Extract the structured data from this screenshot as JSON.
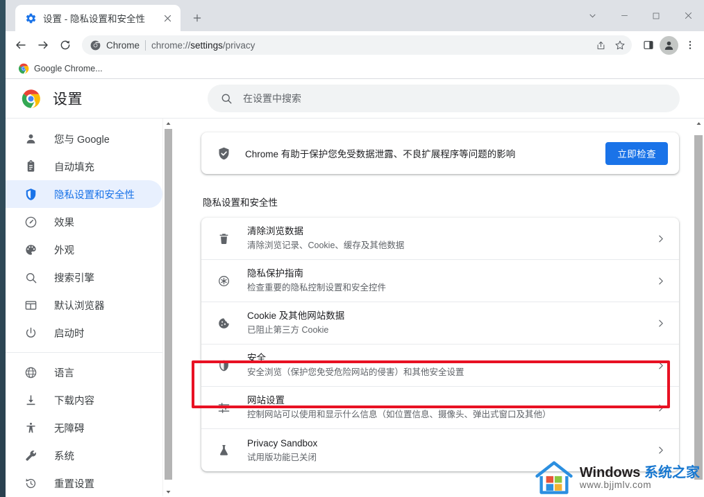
{
  "window": {
    "controls": [
      {
        "name": "tab-search-button",
        "glyph": "chevron-down"
      },
      {
        "name": "minimize-button",
        "glyph": "minimize"
      },
      {
        "name": "maximize-button",
        "glyph": "maximize"
      },
      {
        "name": "close-button",
        "glyph": "close"
      }
    ]
  },
  "tab": {
    "title": "设置 - 隐私设置和安全性",
    "favicon": "gear-icon",
    "close_label": "×",
    "newtab_label": "+"
  },
  "toolbar": {
    "back": "back-arrow-icon",
    "forward": "forward-arrow-icon",
    "reload": "reload-icon",
    "omnibox": {
      "chip_label": "Chrome",
      "chip_icon": "chrome-icon",
      "url_prefix": "chrome://",
      "url_bold": "settings",
      "url_suffix": "/privacy",
      "share_icon": "share-icon",
      "bookmark_icon": "star-icon"
    },
    "side_panel": "side-panel-icon",
    "profile": "profile-avatar-icon",
    "menu": "three-dot-menu-icon"
  },
  "bookmarks": [
    {
      "label": "Google Chrome...",
      "icon": "chrome-icon"
    }
  ],
  "settings": {
    "brand_title": "设置",
    "brand_icon": "chrome-logo-icon",
    "search": {
      "placeholder": "在设置中搜索",
      "value": "",
      "icon": "search-icon"
    },
    "sidebar": {
      "group_a": [
        {
          "label": "您与 Google",
          "icon": "person-icon",
          "active": false
        },
        {
          "label": "自动填充",
          "icon": "clipboard-icon",
          "active": false
        },
        {
          "label": "隐私设置和安全性",
          "icon": "shield-icon",
          "active": true
        },
        {
          "label": "效果",
          "icon": "speedometer-icon",
          "active": false
        },
        {
          "label": "外观",
          "icon": "palette-icon",
          "active": false
        },
        {
          "label": "搜索引擎",
          "icon": "search-icon",
          "active": false
        },
        {
          "label": "默认浏览器",
          "icon": "browser-window-icon",
          "active": false
        },
        {
          "label": "启动时",
          "icon": "power-icon",
          "active": false
        }
      ],
      "group_b": [
        {
          "label": "语言",
          "icon": "globe-icon",
          "active": false
        },
        {
          "label": "下载内容",
          "icon": "download-icon",
          "active": false
        },
        {
          "label": "无障碍",
          "icon": "accessibility-icon",
          "active": false
        },
        {
          "label": "系统",
          "icon": "wrench-icon",
          "active": false
        },
        {
          "label": "重置设置",
          "icon": "history-restore-icon",
          "active": false
        }
      ]
    },
    "safety_check": {
      "icon": "shield-check-icon",
      "text": "Chrome 有助于保护您免受数据泄露、不良扩展程序等问题的影响",
      "button_label": "立即检查"
    },
    "section_title": "隐私设置和安全性",
    "rows": [
      {
        "icon": "trash-icon",
        "title": "清除浏览数据",
        "sub": "清除浏览记录、Cookie、缓存及其他数据",
        "highlighted": false
      },
      {
        "icon": "privacy-guide-icon",
        "title": "隐私保护指南",
        "sub": "检查重要的隐私控制设置和安全控件",
        "highlighted": false
      },
      {
        "icon": "cookie-icon",
        "title": "Cookie 及其他网站数据",
        "sub": "已阻止第三方 Cookie",
        "highlighted": false
      },
      {
        "icon": "shield-icon",
        "title": "安全",
        "sub": "安全浏览（保护您免受危险网站的侵害）和其他安全设置",
        "highlighted": false
      },
      {
        "icon": "tune-sliders-icon",
        "title": "网站设置",
        "sub": "控制网站可以使用和显示什么信息（如位置信息、摄像头、弹出式窗口及其他）",
        "highlighted": true
      },
      {
        "icon": "flask-icon",
        "title": "Privacy Sandbox",
        "sub": "试用版功能已关闭",
        "highlighted": false
      }
    ]
  },
  "watermark": {
    "brand_en": "Windows ",
    "brand_cn": "系统之家",
    "url": "www.bjjmlv.com",
    "logo": "windows-house-logo-icon"
  },
  "colors": {
    "accent_blue": "#1a73e8",
    "active_pill": "#e8f0fe",
    "annotation_red": "#e81123",
    "tabstrip_bg": "#dee1e6",
    "omnibox_bg": "#f1f3f4"
  }
}
